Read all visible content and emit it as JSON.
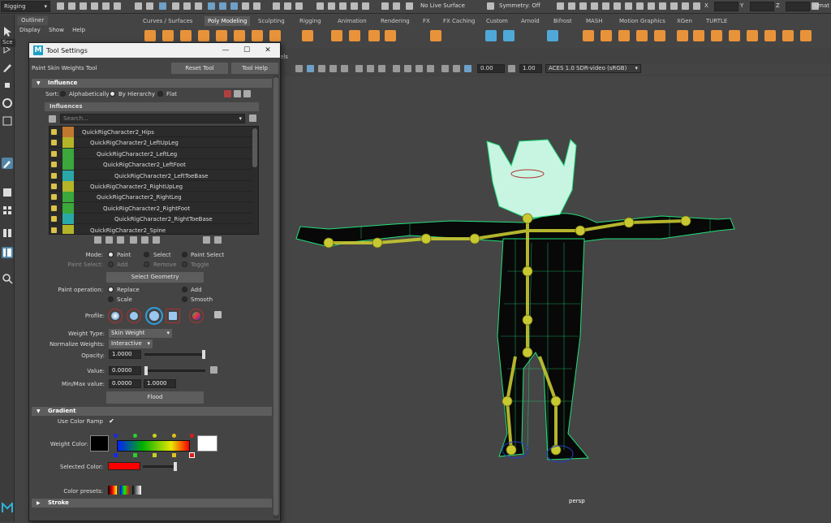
{
  "status_line": {
    "menu_set": "Rigging",
    "live_surface": "No Live Surface",
    "symmetry": "Symmetry: Off",
    "xyz_labels": [
      "X",
      "Y",
      "Z"
    ],
    "user": "umat"
  },
  "outliner": {
    "tab": "Outliner",
    "menu": [
      "Display",
      "Show",
      "Help"
    ],
    "search_stub": "Sce"
  },
  "shelf": {
    "tabs": [
      "Curves / Surfaces",
      "Poly Modeling",
      "Sculpting",
      "Rigging",
      "Animation",
      "Rendering",
      "FX",
      "FX Caching",
      "Custom",
      "Arnold",
      "Bifrost",
      "MASH",
      "Motion Graphics",
      "XGen",
      "TURTLE"
    ],
    "active_tab": "Poly Modeling"
  },
  "viewport": {
    "menu_tail": "els",
    "gamma_value": "0.00",
    "exposure_value": "1.00",
    "color_space": "ACES 1.0 SDR-video (sRGB)",
    "camera": "persp"
  },
  "tool_settings": {
    "title": "Tool Settings",
    "tool_name": "Paint Skin Weights Tool",
    "reset_button": "Reset Tool",
    "help_button": "Tool Help",
    "window_controls": [
      "—",
      "☐",
      "✕"
    ],
    "influence": {
      "header": "Influence",
      "sort_label": "Sort:",
      "sort_options": [
        "Alphabetically",
        "By Hierarchy",
        "Flat"
      ],
      "sort_selected": "By Hierarchy",
      "influences_header": "Influences",
      "search_placeholder": "Search...",
      "joints": [
        {
          "name": "QuickRigCharacter2_Hips",
          "color": "#c0782e"
        },
        {
          "name": "QuickRigCharacter2_LeftUpLeg",
          "color": "#b4b428"
        },
        {
          "name": "QuickRigCharacter2_LeftLeg",
          "color": "#3aa83a"
        },
        {
          "name": "QuickRigCharacter2_LeftFoot",
          "color": "#3aa83a"
        },
        {
          "name": "QuickRigCharacter2_LeftToeBase",
          "color": "#2aa8a8"
        },
        {
          "name": "QuickRigCharacter2_RightUpLeg",
          "color": "#b4b428"
        },
        {
          "name": "QuickRigCharacter2_RightLeg",
          "color": "#3aa83a"
        },
        {
          "name": "QuickRigCharacter2_RightFoot",
          "color": "#3aa83a"
        },
        {
          "name": "QuickRigCharacter2_RightToeBase",
          "color": "#2aa8a8"
        },
        {
          "name": "QuickRigCharacter2_Spine",
          "color": "#b4b428"
        }
      ],
      "mode_label": "Mode:",
      "mode_options": [
        "Paint",
        "Select",
        "Paint Select"
      ],
      "mode_selected": "Paint",
      "paint_select_label": "Paint Select:",
      "paint_select_options": [
        "Add",
        "Remove",
        "Toggle"
      ],
      "select_geometry_button": "Select Geometry",
      "paint_operation_label": "Paint operation:",
      "paint_operations": [
        "Replace",
        "Add",
        "Scale",
        "Smooth"
      ],
      "paint_operation_selected": "Replace",
      "profile_label": "Profile:",
      "weight_type_label": "Weight Type:",
      "weight_type_value": "Skin Weight",
      "normalize_label": "Normalize Weights:",
      "normalize_value": "Interactive",
      "opacity_label": "Opacity:",
      "opacity_value": "1.0000",
      "opacity_level": 1.0,
      "value_label": "Value:",
      "value_value": "0.0000",
      "value_level": 0.0,
      "minmax_label": "Min/Max value:",
      "min_value": "0.0000",
      "max_value": "1.0000",
      "flood_button": "Flood"
    },
    "gradient": {
      "header": "Gradient",
      "use_color_ramp_label": "Use Color Ramp",
      "use_color_ramp_checked": true,
      "weight_color_label": "Weight Color:",
      "selected_color_label": "Selected Color:",
      "selected_color": "#ff0000",
      "color_presets_label": "Color presets:"
    },
    "stroke_header": "Stroke"
  },
  "colors": {
    "accent_blue": "#5285a6",
    "shelf_orange": "#e8933a",
    "mesh_green": "#21e07a",
    "joint_yellow": "#c8c832"
  }
}
